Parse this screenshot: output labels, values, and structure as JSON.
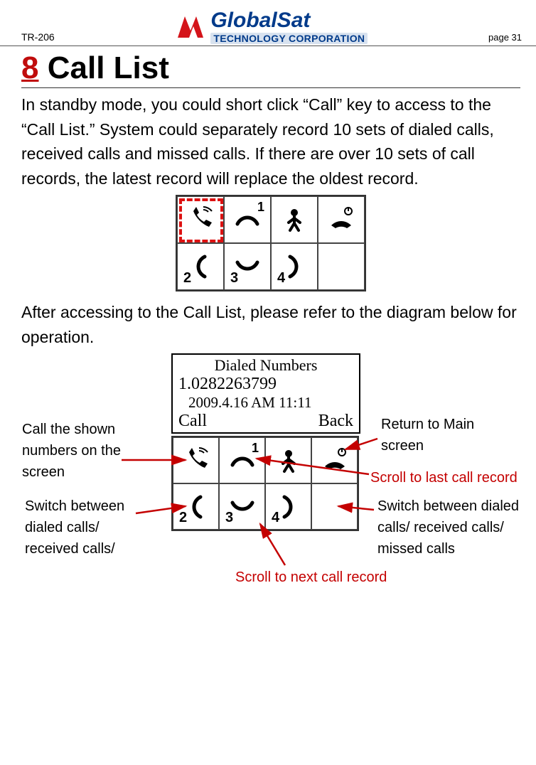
{
  "header": {
    "doc_id": "TR-206",
    "page_label": "page 31",
    "logo_top": "GlobalSat",
    "logo_bottom": "TECHNOLOGY CORPORATION"
  },
  "section": {
    "number": "8",
    "title": "Call List"
  },
  "paragraphs": {
    "p1": "In standby mode, you could short click “Call” key to access to the “Call List.” System could separately record 10 sets of dialed calls, received calls and missed calls. If there are over 10 sets of call records, the latest record will replace the oldest record.",
    "p2": "After accessing to the Call List, please refer to the diagram below for operation."
  },
  "phone_screen": {
    "title": "Dialed Numbers",
    "entry": "1.0282263799",
    "timestamp": "2009.4.16 AM 11:11",
    "left_action": "Call",
    "right_action": "Back"
  },
  "annotations": {
    "call_shown": "Call the shown numbers on the screen",
    "switch_left": "Switch between dialed calls/ received calls/",
    "return_main": "Return to Main screen",
    "scroll_last": "Scroll to last call record",
    "switch_right": "Switch between dialed calls/ received calls/ missed calls",
    "scroll_next": "Scroll to next call record"
  },
  "keys": {
    "k1_sup": "1",
    "k2_sub": "2",
    "k3_sub": "3",
    "k4_sub": "4"
  }
}
